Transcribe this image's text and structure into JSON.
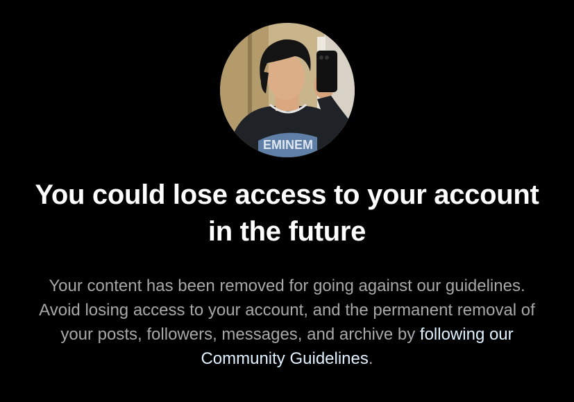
{
  "screen": {
    "avatar_icon": "profile-photo",
    "title": "You could lose access to your account in the future",
    "body_text": "Your content has been removed for going against our guidelines. Avoid losing access to your account, and the permanent removal of your posts, followers, messages, and archive by ",
    "link_text": "following our Community Guidelines",
    "body_suffix": ".",
    "colors": {
      "background": "#000000",
      "title": "#ffffff",
      "body": "#a8a8a8",
      "link": "#e0f1ff"
    }
  }
}
